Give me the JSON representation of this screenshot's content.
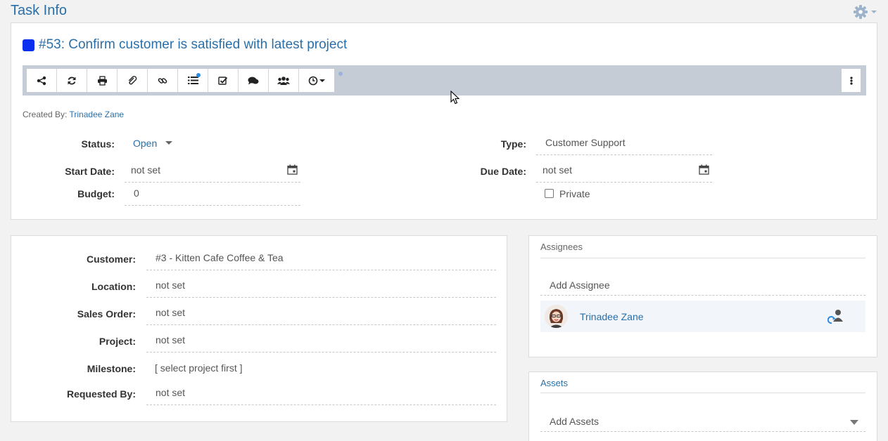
{
  "page": {
    "title": "Task Info"
  },
  "task": {
    "title": "#53: Confirm customer is satisfied with latest project",
    "color": "#0a2ef0",
    "created_label": "Created By:",
    "created_by": "Trinadee Zane"
  },
  "toolbar": {
    "buttons": [
      "share-icon",
      "refresh-icon",
      "print-icon",
      "paperclip-icon",
      "link-icon",
      "list-icon",
      "checkbox-icon",
      "comments-icon",
      "group-icon",
      "clock-icon"
    ],
    "more": "vertical-dots-icon"
  },
  "fields": {
    "status_label": "Status:",
    "status_value": "Open",
    "start_label": "Start Date:",
    "start_value": "not set",
    "budget_label": "Budget:",
    "budget_value": "0",
    "type_label": "Type:",
    "type_value": "Customer Support",
    "due_label": "Due Date:",
    "due_value": "not set",
    "private_label": "Private"
  },
  "details": {
    "customer_label": "Customer:",
    "customer_value": "#3 - Kitten Cafe Coffee & Tea",
    "location_label": "Location:",
    "location_value": "not set",
    "sales_order_label": "Sales Order:",
    "sales_order_value": "not set",
    "project_label": "Project:",
    "project_value": "not set",
    "milestone_label": "Milestone:",
    "milestone_value": "[ select project first ]",
    "requested_label": "Requested By:",
    "requested_value": "not set"
  },
  "assignees": {
    "heading": "Assignees",
    "add_placeholder": "Add Assignee",
    "items": [
      {
        "name": "Trinadee Zane"
      }
    ]
  },
  "assets": {
    "heading": "Assets",
    "add_placeholder": "Add Assets"
  }
}
